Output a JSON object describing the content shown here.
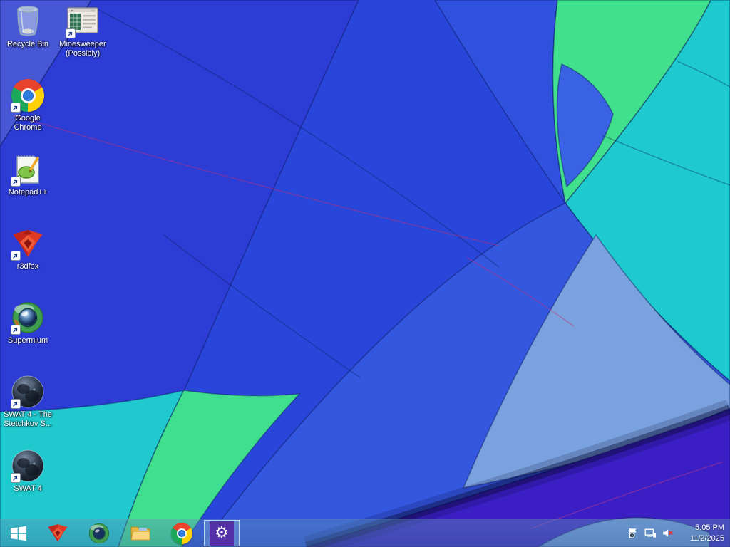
{
  "desktop": {
    "icons": [
      {
        "id": "recycle-bin",
        "label": "Recycle Bin",
        "shortcut": false
      },
      {
        "id": "minesweeper",
        "label": "Minesweeper (Possibly)",
        "shortcut": true
      },
      {
        "id": "google-chrome",
        "label": "Google Chrome",
        "shortcut": true
      },
      {
        "id": "notepad-plus-plus",
        "label": "Notepad++",
        "shortcut": true
      },
      {
        "id": "r3dfox",
        "label": "r3dfox",
        "shortcut": true
      },
      {
        "id": "supermium",
        "label": "Supermium",
        "shortcut": true
      },
      {
        "id": "swat4-stetchkov",
        "label": "SWAT 4 - The Stetchkov S...",
        "shortcut": true
      },
      {
        "id": "swat4",
        "label": "SWAT 4",
        "shortcut": true
      }
    ]
  },
  "taskbar": {
    "pinned": [
      {
        "id": "start",
        "icon": "windows-logo"
      },
      {
        "id": "r3dfox",
        "icon": "r3dfox-fox"
      },
      {
        "id": "supermium",
        "icon": "supermium-orb"
      },
      {
        "id": "file-explorer",
        "icon": "folder"
      },
      {
        "id": "chrome",
        "icon": "chrome-disc"
      },
      {
        "id": "settings",
        "icon": "gear",
        "active": true,
        "gear_glyph": "⚙"
      }
    ],
    "tray": {
      "icons": [
        {
          "id": "action-center",
          "icon": "flag-clock"
        },
        {
          "id": "network",
          "icon": "wired-network"
        },
        {
          "id": "volume",
          "icon": "speaker-muted",
          "status": "muted"
        }
      ],
      "clock": {
        "time": "5:05 PM",
        "date": "11/2/2025"
      }
    }
  },
  "wallpaper": {
    "description": "Windows 8.1 default balloon close-up",
    "colors": {
      "deep_blue": "#2946da",
      "periwinkle": "#4757d6",
      "royal_blue": "#2c3cd5",
      "teal": "#1fc9ce",
      "green": "#3fdf8d",
      "teal_right": "#1ecacd",
      "green_top": "#40e08d",
      "blue_tip": "#3a62e4",
      "sliver_blue": "#3050de",
      "medium_blue": "#3457e0",
      "light_steel": "#7aa2de",
      "indigo": "#3b1fc4",
      "bottom_strip": "#6f92d8",
      "seam": "#0a1450",
      "stitch_red": "#cd2d6e"
    }
  },
  "brand_colors": {
    "chrome_red": "#e8432d",
    "chrome_yellow": "#fdd106",
    "chrome_green": "#1ba85a",
    "chrome_blue": "#2f7de1",
    "settings_tile_purple": "#5430a8",
    "mute_x_red": "#e0392e",
    "r3dfox_red": "#d42a1e"
  }
}
